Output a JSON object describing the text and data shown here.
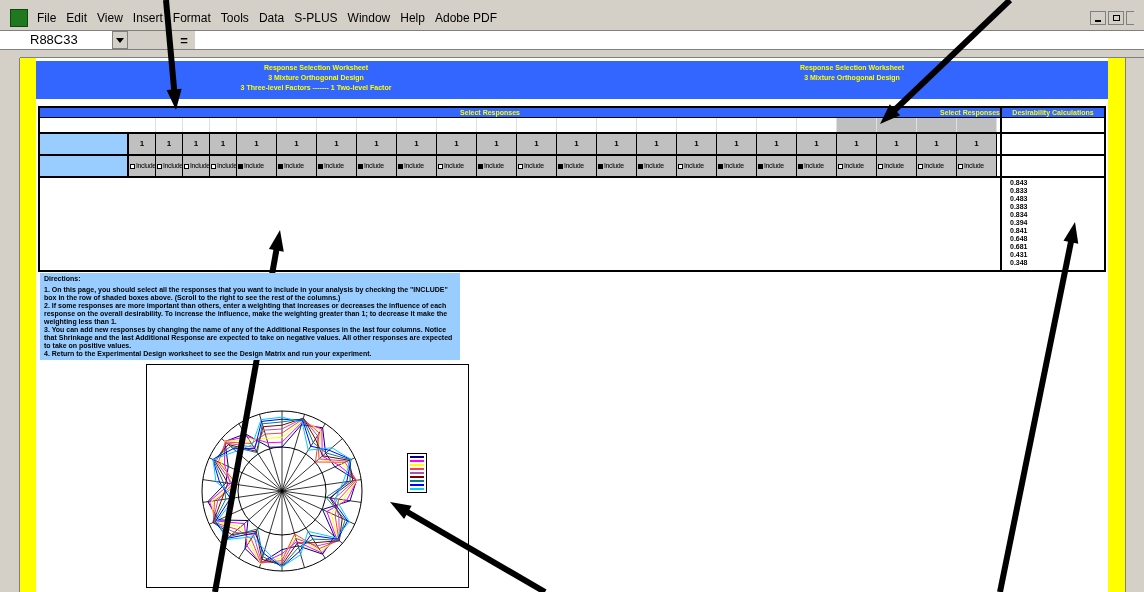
{
  "menu": [
    "File",
    "Edit",
    "View",
    "Insert",
    "Format",
    "Tools",
    "Data",
    "S-PLUS",
    "Window",
    "Help",
    "Adobe PDF"
  ],
  "name_box": "R88C33",
  "formula_sign": "=",
  "banner": {
    "title": "Response Selection Worksheet",
    "subtitle": "3 Mixture Orthogonal Design",
    "factors": "3 Three-level Factors ------- 1 Two-level Factor",
    "right_title": "Response Selection Worksheet",
    "right_subtitle": "3 Mixture Orthogonal Design"
  },
  "table": {
    "section_title": "Select Responses",
    "section_title_right": "Select Responses",
    "desirability_title": "Desirability Calculations",
    "responses": [
      {
        "kind": "narrow",
        "weight": "1",
        "include": "Include",
        "checked": false,
        "additional": false
      },
      {
        "kind": "narrow",
        "weight": "1",
        "include": "Include",
        "checked": false,
        "additional": false
      },
      {
        "kind": "narrow",
        "weight": "1",
        "include": "Include",
        "checked": false,
        "additional": false
      },
      {
        "kind": "narrow",
        "weight": "1",
        "include": "Include",
        "checked": false,
        "additional": false
      },
      {
        "kind": "wide",
        "weight": "1",
        "include": "Include",
        "checked": true,
        "additional": false
      },
      {
        "kind": "wide",
        "weight": "1",
        "include": "Include",
        "checked": true,
        "additional": false
      },
      {
        "kind": "wide",
        "weight": "1",
        "include": "Include",
        "checked": true,
        "additional": false
      },
      {
        "kind": "wide",
        "weight": "1",
        "include": "Include",
        "checked": true,
        "additional": false
      },
      {
        "kind": "wide",
        "weight": "1",
        "include": "Include",
        "checked": true,
        "additional": false
      },
      {
        "kind": "wide",
        "weight": "1",
        "include": "Include",
        "checked": false,
        "additional": false
      },
      {
        "kind": "wide",
        "weight": "1",
        "include": "Include",
        "checked": true,
        "additional": false
      },
      {
        "kind": "wide",
        "weight": "1",
        "include": "Include",
        "checked": false,
        "additional": false
      },
      {
        "kind": "wide",
        "weight": "1",
        "include": "Include",
        "checked": true,
        "additional": false
      },
      {
        "kind": "wide",
        "weight": "1",
        "include": "Include",
        "checked": true,
        "additional": false
      },
      {
        "kind": "wide",
        "weight": "1",
        "include": "Include",
        "checked": true,
        "additional": false
      },
      {
        "kind": "wide",
        "weight": "1",
        "include": "Include",
        "checked": false,
        "additional": false
      },
      {
        "kind": "wide",
        "weight": "1",
        "include": "Include",
        "checked": true,
        "additional": false
      },
      {
        "kind": "wide",
        "weight": "1",
        "include": "Include",
        "checked": true,
        "additional": false
      },
      {
        "kind": "wide",
        "weight": "1",
        "include": "Include",
        "checked": true,
        "additional": false
      },
      {
        "kind": "wide",
        "weight": "1",
        "include": "Include",
        "checked": false,
        "additional": true
      },
      {
        "kind": "wide",
        "weight": "1",
        "include": "Include",
        "checked": false,
        "additional": true
      },
      {
        "kind": "wide",
        "weight": "1",
        "include": "Include",
        "checked": false,
        "additional": true
      },
      {
        "kind": "wide",
        "weight": "1",
        "include": "Include",
        "checked": false,
        "additional": true
      }
    ],
    "desirability": [
      "0.843",
      "0.833",
      "0.483",
      "0.383",
      "0.834",
      "0.394",
      "0.841",
      "0.648",
      "0.681",
      "0.431",
      "0.348"
    ]
  },
  "directions": {
    "heading": "Directions:",
    "items": [
      "1. On this page, you should select all the responses that you want to include in your analysis by checking the \"INCLUDE\" box in the row of shaded boxes above. (Scroll to the right to see the rest of the columns.)",
      "2. If some responses are more important than others, enter a weighting that increases or decreases the influence of each response on the overall desirability. To increase the influence, make the weighting greater than 1; to decrease it make the weighting less than 1.",
      "3. You can add new responses by changing the name of any of the Additional Responses in the last four columns. Notice that Shrinkage and the last Additional Response are expected to take on negative values. All other responses are expected to take on positive values.",
      "4. Return to the Experimental Design worksheet to see the Design Matrix and run your experiment."
    ]
  },
  "chart": {
    "legend": [
      {
        "color": "#000080"
      },
      {
        "color": "#ff00ff"
      },
      {
        "color": "#ffff00"
      },
      {
        "color": "#ff4040"
      },
      {
        "color": "#aa55aa"
      },
      {
        "color": "#800000"
      },
      {
        "color": "#008080"
      },
      {
        "color": "#0000ff"
      },
      {
        "color": "#00ccff"
      }
    ]
  }
}
